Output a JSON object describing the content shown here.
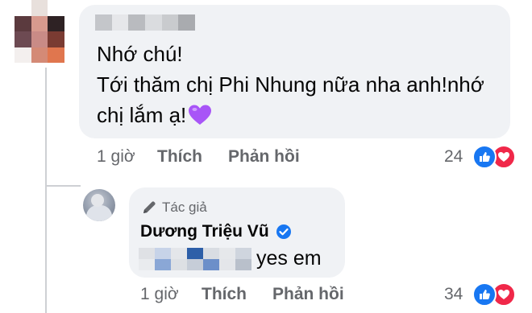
{
  "comment": {
    "lines": [
      "Nhớ chú!",
      "Tới thăm chị Phi Nhung nữa nha anh!nhớ",
      "chị lắm ạ!"
    ],
    "emoji_icon": "purple-heart-emoji",
    "time": "1 giờ",
    "like_label": "Thích",
    "reply_label": "Phản hồi",
    "reaction_count": "24"
  },
  "reply": {
    "author_badge": "Tác giả",
    "author_name": "Dương Triệu Vũ",
    "text": "yes em",
    "time": "1 giờ",
    "like_label": "Thích",
    "reply_label": "Phản hồi",
    "reaction_count": "34"
  },
  "icons": {
    "like": "like-reaction-icon",
    "love": "love-reaction-icon",
    "pencil": "pencil-icon",
    "verified": "verified-badge-icon"
  },
  "colors": {
    "bubble": "#f0f2f5",
    "meta_text": "#65676b",
    "like_blue": "#1877f2",
    "love_red": "#f02849",
    "verified_blue": "#1877f2",
    "heart_purple": "#a855f7"
  }
}
